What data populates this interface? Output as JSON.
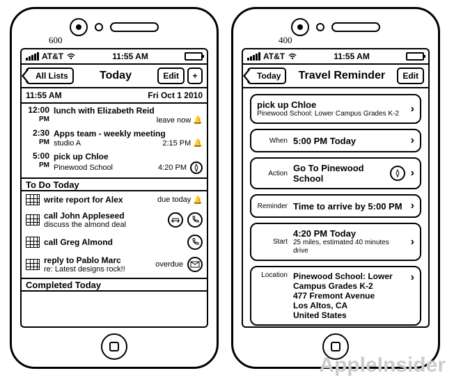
{
  "annotations": {
    "left_fig": "600",
    "right_fig": "400"
  },
  "watermark": "AppleInsider",
  "left": {
    "status": {
      "carrier": "AT&T",
      "time": "11:55 AM"
    },
    "nav": {
      "back": "All Lists",
      "title": "Today",
      "edit": "Edit",
      "plus": "+"
    },
    "subhead": {
      "time": "11:55 AM",
      "date": "Fri Oct 1 2010"
    },
    "events": [
      {
        "hour": "12:00",
        "ampm": "PM",
        "title": "lunch with Elizabeth Reid",
        "sub_left": "",
        "sub_right": "leave now",
        "trailing_icon": "bell"
      },
      {
        "hour": "2:30",
        "ampm": "PM",
        "title": "Apps team - weekly meeting",
        "sub_left": "studio A",
        "sub_right": "2:15 PM",
        "trailing_icon": "bell"
      },
      {
        "hour": "5:00",
        "ampm": "PM",
        "title": "pick up Chloe",
        "sub_left": "Pinewood School",
        "sub_right": "4:20 PM",
        "trailing_icon": "compass"
      }
    ],
    "section_todo": "To Do Today",
    "todos": [
      {
        "title": "write report for Alex",
        "sub": "",
        "right": "due today",
        "right_icon": "bell",
        "icons": []
      },
      {
        "title": "call John Appleseed",
        "sub": "discuss the almond deal",
        "right": "",
        "right_icon": "",
        "icons": [
          "car",
          "phone"
        ]
      },
      {
        "title": "call Greg Almond",
        "sub": "",
        "right": "",
        "right_icon": "",
        "icons": [
          "phone"
        ]
      },
      {
        "title": "reply to Pablo Marc",
        "sub": "re: Latest designs rock!!",
        "right": "overdue",
        "right_icon": "",
        "icons": [
          "mail"
        ]
      }
    ],
    "section_completed": "Completed Today"
  },
  "right": {
    "status": {
      "carrier": "AT&T",
      "time": "11:55 AM"
    },
    "nav": {
      "back": "Today",
      "title": "Travel Reminder",
      "edit": "Edit"
    },
    "cards": {
      "header": {
        "title": "pick up Chloe",
        "sub": "Pinewood School: Lower Campus Grades K-2"
      },
      "when": {
        "label": "When",
        "value": "5:00 PM Today"
      },
      "action": {
        "label": "Action",
        "value": "Go To Pinewood School"
      },
      "reminder": {
        "label": "Reminder",
        "value": "Time to arrive by 5:00 PM"
      },
      "start": {
        "label": "Start",
        "value": "4:20 PM Today",
        "sub": "25 miles, estimated 40 minutes drive"
      },
      "location": {
        "label": "Location",
        "value": "Pinewood School: Lower Campus Grades K-2\n477 Fremont Avenue\nLos Altos, CA\nUnited States"
      }
    }
  }
}
